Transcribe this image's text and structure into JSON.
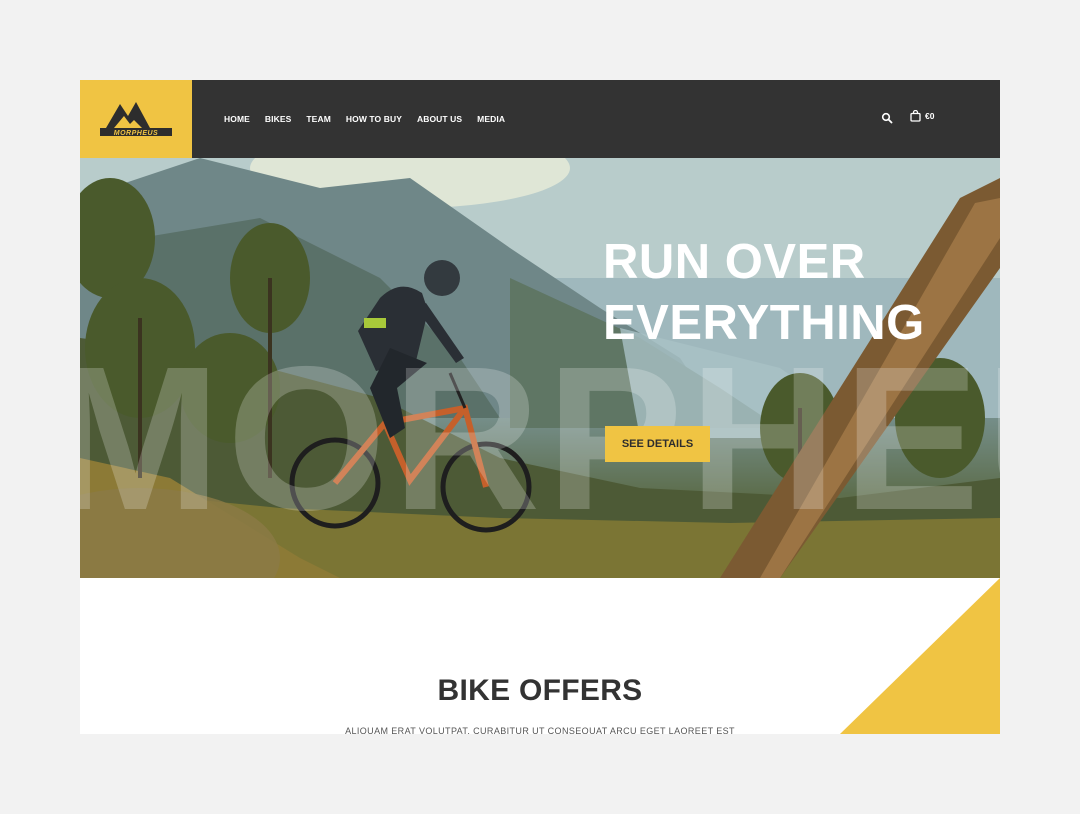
{
  "brand": {
    "logo_text": "MORPHEUS",
    "accent_color": "#f0c443",
    "header_color": "#333333"
  },
  "nav": {
    "items": [
      {
        "label": "HOME"
      },
      {
        "label": "BIKES"
      },
      {
        "label": "TEAM"
      },
      {
        "label": "HOW TO BUY"
      },
      {
        "label": "ABOUT US"
      },
      {
        "label": "MEDIA"
      }
    ]
  },
  "header": {
    "search_icon": "search-icon",
    "cart_icon": "shopping-bag-icon",
    "cart_total": "€0"
  },
  "hero": {
    "title_line1": "RUN OVER",
    "title_line2": "EVERYTHING",
    "watermark": "MORPHEUS",
    "cta_label": "SEE DETAILS"
  },
  "offers": {
    "title": "BIKE OFFERS",
    "subtitle": "ALIQUAM ERAT VOLUTPAT. CURABITUR UT CONSEQUAT ARCU EGET LAOREET EST"
  }
}
